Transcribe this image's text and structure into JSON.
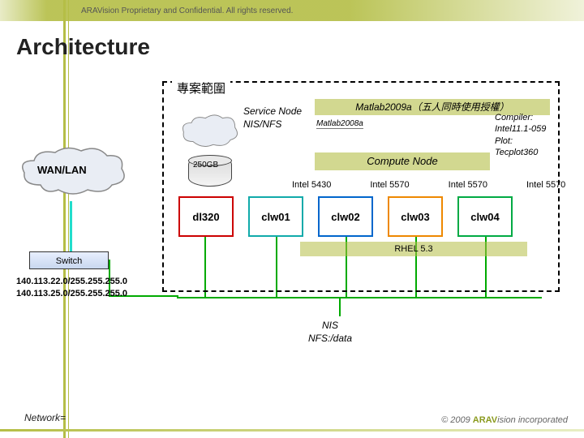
{
  "header": {
    "confidential": "ARAVision Proprietary and Confidential. All rights reserved."
  },
  "title": "Architecture",
  "project_scope": "專案範圍",
  "service_node": {
    "l1": "Service Node",
    "l2": "NIS/NFS"
  },
  "matlab_license": "Matlab2009a（五人同時使用授權）",
  "matlab2008": "Matlab2008a",
  "compiler": {
    "l1": "Compiler:",
    "l2": "Intel11.1-059",
    "l3": "Plot:",
    "l4": "Tecplot360"
  },
  "storage": "250GB",
  "compute_node": "Compute Node",
  "cpus": {
    "c1": "Intel 5430",
    "c2": "Intel 5570",
    "c3": "Intel 5570",
    "c4": "Intel 5570"
  },
  "nodes": {
    "n0": "dl320",
    "n1": "clw01",
    "n2": "clw02",
    "n3": "clw03",
    "n4": "clw04"
  },
  "rhel": "RHEL 5.3",
  "wan": "WAN/LAN",
  "switch": "Switch",
  "networks": {
    "a": "140.113.22.0/255.255.255.0",
    "b": "140.113.25.0/255.255.255.0"
  },
  "nis": {
    "l1": "NIS",
    "l2": "NFS:/data"
  },
  "footer": {
    "network": "Network=",
    "copy_pre": "© 2009 ",
    "copy_brand": "ARAV",
    "copy_post": "ision incorporated"
  }
}
